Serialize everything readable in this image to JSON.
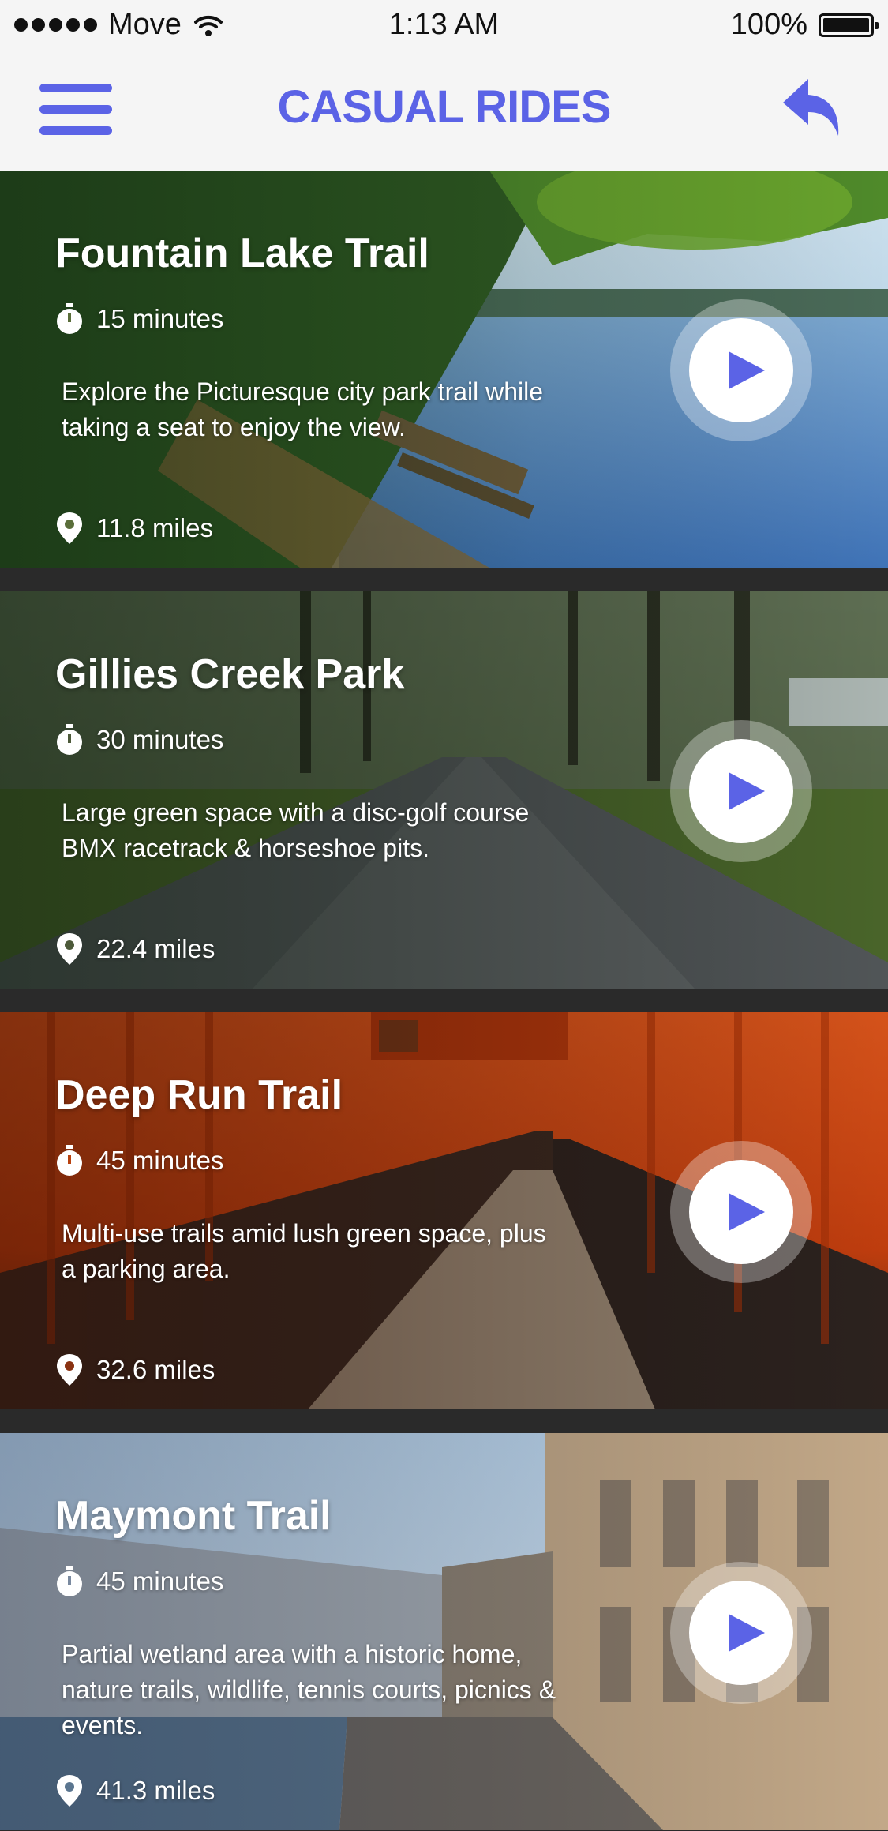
{
  "status": {
    "carrier": "Move",
    "time": "1:13 AM",
    "battery": "100%"
  },
  "header": {
    "title": "CASUAL RIDES",
    "menu_icon": "hamburger-menu-icon",
    "back_icon": "reply-back-icon"
  },
  "colors": {
    "accent": "#5b63e6",
    "status_bg": "#f5f5f5",
    "separator": "#2a2a2a"
  },
  "rides": [
    {
      "title": "Fountain Lake Trail",
      "duration": "15 minutes",
      "description": "Explore the Picturesque city park trail while taking a seat to enjoy the view.",
      "distance": "11.8 miles"
    },
    {
      "title": "Gillies Creek Park",
      "duration": "30 minutes",
      "description": "Large green space with a disc-golf course BMX racetrack & horseshoe pits.",
      "distance": "22.4 miles"
    },
    {
      "title": "Deep Run Trail",
      "duration": "45 minutes",
      "description": "Multi-use trails amid lush green space, plus a parking area.",
      "distance": "32.6 miles"
    },
    {
      "title": "Maymont Trail",
      "duration": "45 minutes",
      "description": "Partial wetland area with a historic home, nature trails, wildlife, tennis courts, picnics & events.",
      "distance": "41.3 miles"
    }
  ]
}
